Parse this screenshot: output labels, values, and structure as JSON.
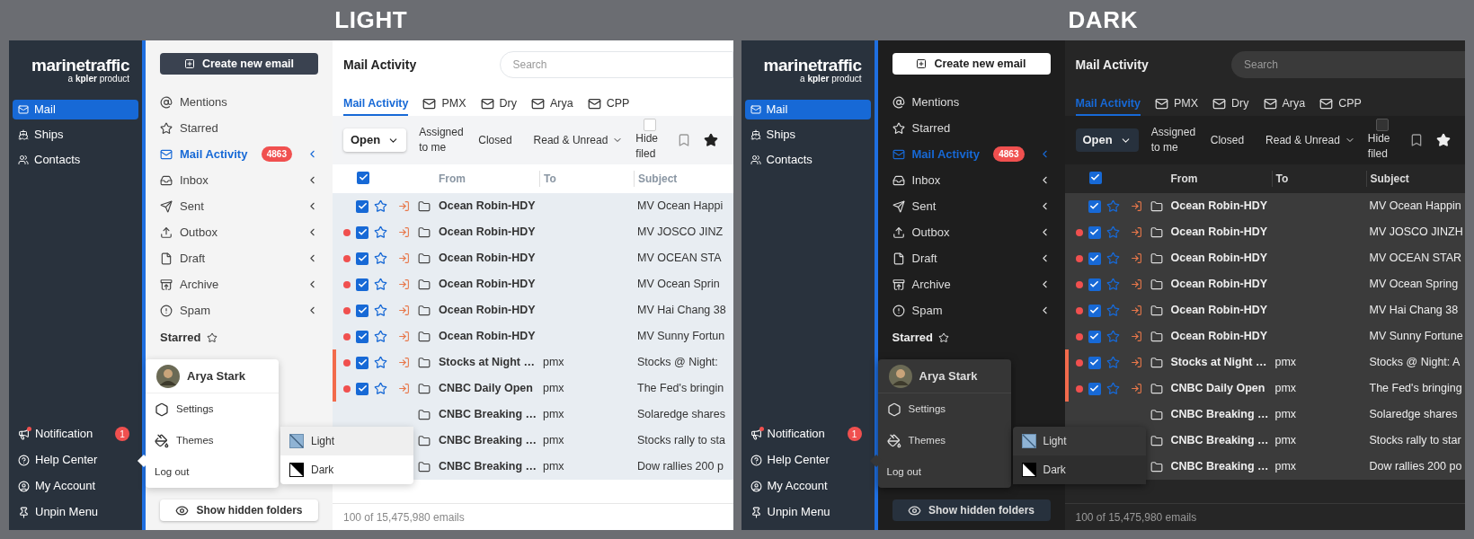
{
  "panels": [
    {
      "kind": "light",
      "heading": "LIGHT",
      "logo": {
        "name": "marinetraffic",
        "tagline_prefix": "a",
        "tagline_brand": "kpler",
        "tagline_suffix": "product"
      },
      "nav": [
        {
          "label": "Mail",
          "selected": true
        },
        {
          "label": "Ships",
          "selected": false
        },
        {
          "label": "Contacts",
          "selected": false
        }
      ],
      "nav_bottom": [
        {
          "label": "Notification",
          "badge": "1"
        },
        {
          "label": "Help Center"
        },
        {
          "label": "My Account"
        },
        {
          "label": "Unpin Menu"
        }
      ],
      "create_button": "Create new email",
      "folders": [
        {
          "label": "Mentions",
          "selected": false,
          "expandable": false
        },
        {
          "label": "Starred",
          "selected": false,
          "expandable": false
        },
        {
          "label": "Mail Activity",
          "selected": true,
          "expandable": true,
          "badge": "4863"
        },
        {
          "label": "Inbox",
          "selected": false,
          "expandable": true
        },
        {
          "label": "Sent",
          "selected": false,
          "expandable": true
        },
        {
          "label": "Outbox",
          "selected": false,
          "expandable": true
        },
        {
          "label": "Draft",
          "selected": false,
          "expandable": true
        },
        {
          "label": "Archive",
          "selected": false,
          "expandable": true
        },
        {
          "label": "Spam",
          "selected": false,
          "expandable": true
        }
      ],
      "starred_heading": "Starred",
      "show_hidden_button": "Show hidden folders",
      "account_menu": {
        "user": "Arya Stark",
        "items": [
          "Settings",
          "Themes",
          "Log out"
        ]
      },
      "theme_menu": [
        {
          "label": "Light",
          "selected": true
        },
        {
          "label": "Dark",
          "selected": false
        }
      ],
      "main": {
        "title": "Mail Activity",
        "search": {
          "placeholder": "Search"
        },
        "tabs": [
          {
            "label": "Mail Activity",
            "selected": true
          },
          {
            "label": "PMX",
            "selected": false
          },
          {
            "label": "Dry",
            "selected": false
          },
          {
            "label": "Arya",
            "selected": false
          },
          {
            "label": "CPP",
            "selected": false
          }
        ],
        "filters": {
          "status": "Open",
          "assigned": "Assigned to me",
          "closed": "Closed",
          "read": "Read & Unread",
          "hide_filed": {
            "label": "Hide filed",
            "checked": false
          }
        },
        "table": {
          "all_checked": true,
          "columns": [
            "From",
            "To",
            "Subject"
          ],
          "rows": [
            {
              "unread": false,
              "checked": true,
              "flagged": false,
              "from": "Ocean Robin-HDY",
              "to": "",
              "subject": "MV Ocean Happi"
            },
            {
              "unread": true,
              "checked": true,
              "flagged": false,
              "from": "Ocean Robin-HDY",
              "to": "",
              "subject": "MV JOSCO JINZ"
            },
            {
              "unread": true,
              "checked": true,
              "flagged": false,
              "from": "Ocean Robin-HDY",
              "to": "",
              "subject": "MV OCEAN STA"
            },
            {
              "unread": true,
              "checked": true,
              "flagged": false,
              "from": "Ocean Robin-HDY",
              "to": "",
              "subject": "MV Ocean Sprin"
            },
            {
              "unread": true,
              "checked": true,
              "flagged": false,
              "from": "Ocean Robin-HDY",
              "to": "",
              "subject": "MV Hai Chang 38"
            },
            {
              "unread": true,
              "checked": true,
              "flagged": false,
              "from": "Ocean Robin-HDY",
              "to": "",
              "subject": "MV Sunny Fortun"
            },
            {
              "unread": true,
              "checked": true,
              "flagged": true,
              "from": "Stocks at Night …",
              "to": "pmx",
              "subject": "Stocks @ Night:"
            },
            {
              "unread": true,
              "checked": true,
              "flagged": true,
              "from": "CNBC Daily Open",
              "to": "pmx",
              "subject": "The Fed's bringin"
            },
            {
              "from": "CNBC Breaking …",
              "to": "pmx",
              "subject": "Solaredge shares"
            },
            {
              "from": "CNBC Breaking …",
              "to": "pmx",
              "subject": "Stocks rally to sta"
            },
            {
              "from": "CNBC Breaking …",
              "to": "pmx",
              "subject": "Dow rallies 200 p"
            }
          ]
        },
        "footer": "100 of 15,475,980 emails"
      }
    },
    {
      "kind": "dark",
      "heading": "DARK",
      "logo": {
        "name": "marinetraffic",
        "tagline_prefix": "a",
        "tagline_brand": "kpler",
        "tagline_suffix": "product"
      },
      "nav": [
        {
          "label": "Mail",
          "selected": true
        },
        {
          "label": "Ships",
          "selected": false
        },
        {
          "label": "Contacts",
          "selected": false
        }
      ],
      "nav_bottom": [
        {
          "label": "Notification",
          "badge": "1"
        },
        {
          "label": "Help Center"
        },
        {
          "label": "My Account"
        },
        {
          "label": "Unpin Menu"
        }
      ],
      "create_button": "Create new email",
      "folders": [
        {
          "label": "Mentions",
          "selected": false,
          "expandable": false
        },
        {
          "label": "Starred",
          "selected": false,
          "expandable": false
        },
        {
          "label": "Mail Activity",
          "selected": true,
          "expandable": true,
          "badge": "4863"
        },
        {
          "label": "Inbox",
          "selected": false,
          "expandable": true
        },
        {
          "label": "Sent",
          "selected": false,
          "expandable": true
        },
        {
          "label": "Outbox",
          "selected": false,
          "expandable": true
        },
        {
          "label": "Draft",
          "selected": false,
          "expandable": true
        },
        {
          "label": "Archive",
          "selected": false,
          "expandable": true
        },
        {
          "label": "Spam",
          "selected": false,
          "expandable": true
        }
      ],
      "starred_heading": "Starred",
      "show_hidden_button": "Show hidden folders",
      "account_menu": {
        "user": "Arya Stark",
        "items": [
          "Settings",
          "Themes",
          "Log out"
        ]
      },
      "theme_menu": [
        {
          "label": "Light",
          "selected": false
        },
        {
          "label": "Dark",
          "selected": true
        }
      ],
      "main": {
        "title": "Mail Activity",
        "search": {
          "placeholder": "Search"
        },
        "tabs": [
          {
            "label": "Mail Activity",
            "selected": true
          },
          {
            "label": "PMX",
            "selected": false
          },
          {
            "label": "Dry",
            "selected": false
          },
          {
            "label": "Arya",
            "selected": false
          },
          {
            "label": "CPP",
            "selected": false
          }
        ],
        "filters": {
          "status": "Open",
          "assigned": "Assigned to me",
          "closed": "Closed",
          "read": "Read & Unread",
          "hide_filed": {
            "label": "Hide filed",
            "checked": false
          }
        },
        "table": {
          "all_checked": true,
          "columns": [
            "From",
            "To",
            "Subject"
          ],
          "rows": [
            {
              "unread": false,
              "checked": true,
              "flagged": false,
              "from": "Ocean Robin-HDY",
              "to": "",
              "subject": "MV Ocean Happin"
            },
            {
              "unread": true,
              "checked": true,
              "flagged": false,
              "from": "Ocean Robin-HDY",
              "to": "",
              "subject": "MV JOSCO JINZH"
            },
            {
              "unread": true,
              "checked": true,
              "flagged": false,
              "from": "Ocean Robin-HDY",
              "to": "",
              "subject": "MV OCEAN STAR"
            },
            {
              "unread": true,
              "checked": true,
              "flagged": false,
              "from": "Ocean Robin-HDY",
              "to": "",
              "subject": "MV Ocean Spring"
            },
            {
              "unread": true,
              "checked": true,
              "flagged": false,
              "from": "Ocean Robin-HDY",
              "to": "",
              "subject": "MV Hai Chang 38"
            },
            {
              "unread": true,
              "checked": true,
              "flagged": false,
              "from": "Ocean Robin-HDY",
              "to": "",
              "subject": "MV Sunny Fortune"
            },
            {
              "unread": true,
              "checked": true,
              "flagged": true,
              "from": "Stocks at Night …",
              "to": "pmx",
              "subject": "Stocks @ Night: A"
            },
            {
              "unread": true,
              "checked": true,
              "flagged": true,
              "from": "CNBC Daily Open",
              "to": "pmx",
              "subject": "The Fed's bringing"
            },
            {
              "from": "CNBC Breaking …",
              "to": "pmx",
              "subject": "Solaredge shares"
            },
            {
              "from": "CNBC Breaking …",
              "to": "pmx",
              "subject": "Stocks rally to star"
            },
            {
              "from": "CNBC Breaking …",
              "to": "pmx",
              "subject": "Dow rallies 200 po"
            }
          ]
        },
        "footer": "100 of 15,475,980 emails"
      }
    }
  ]
}
